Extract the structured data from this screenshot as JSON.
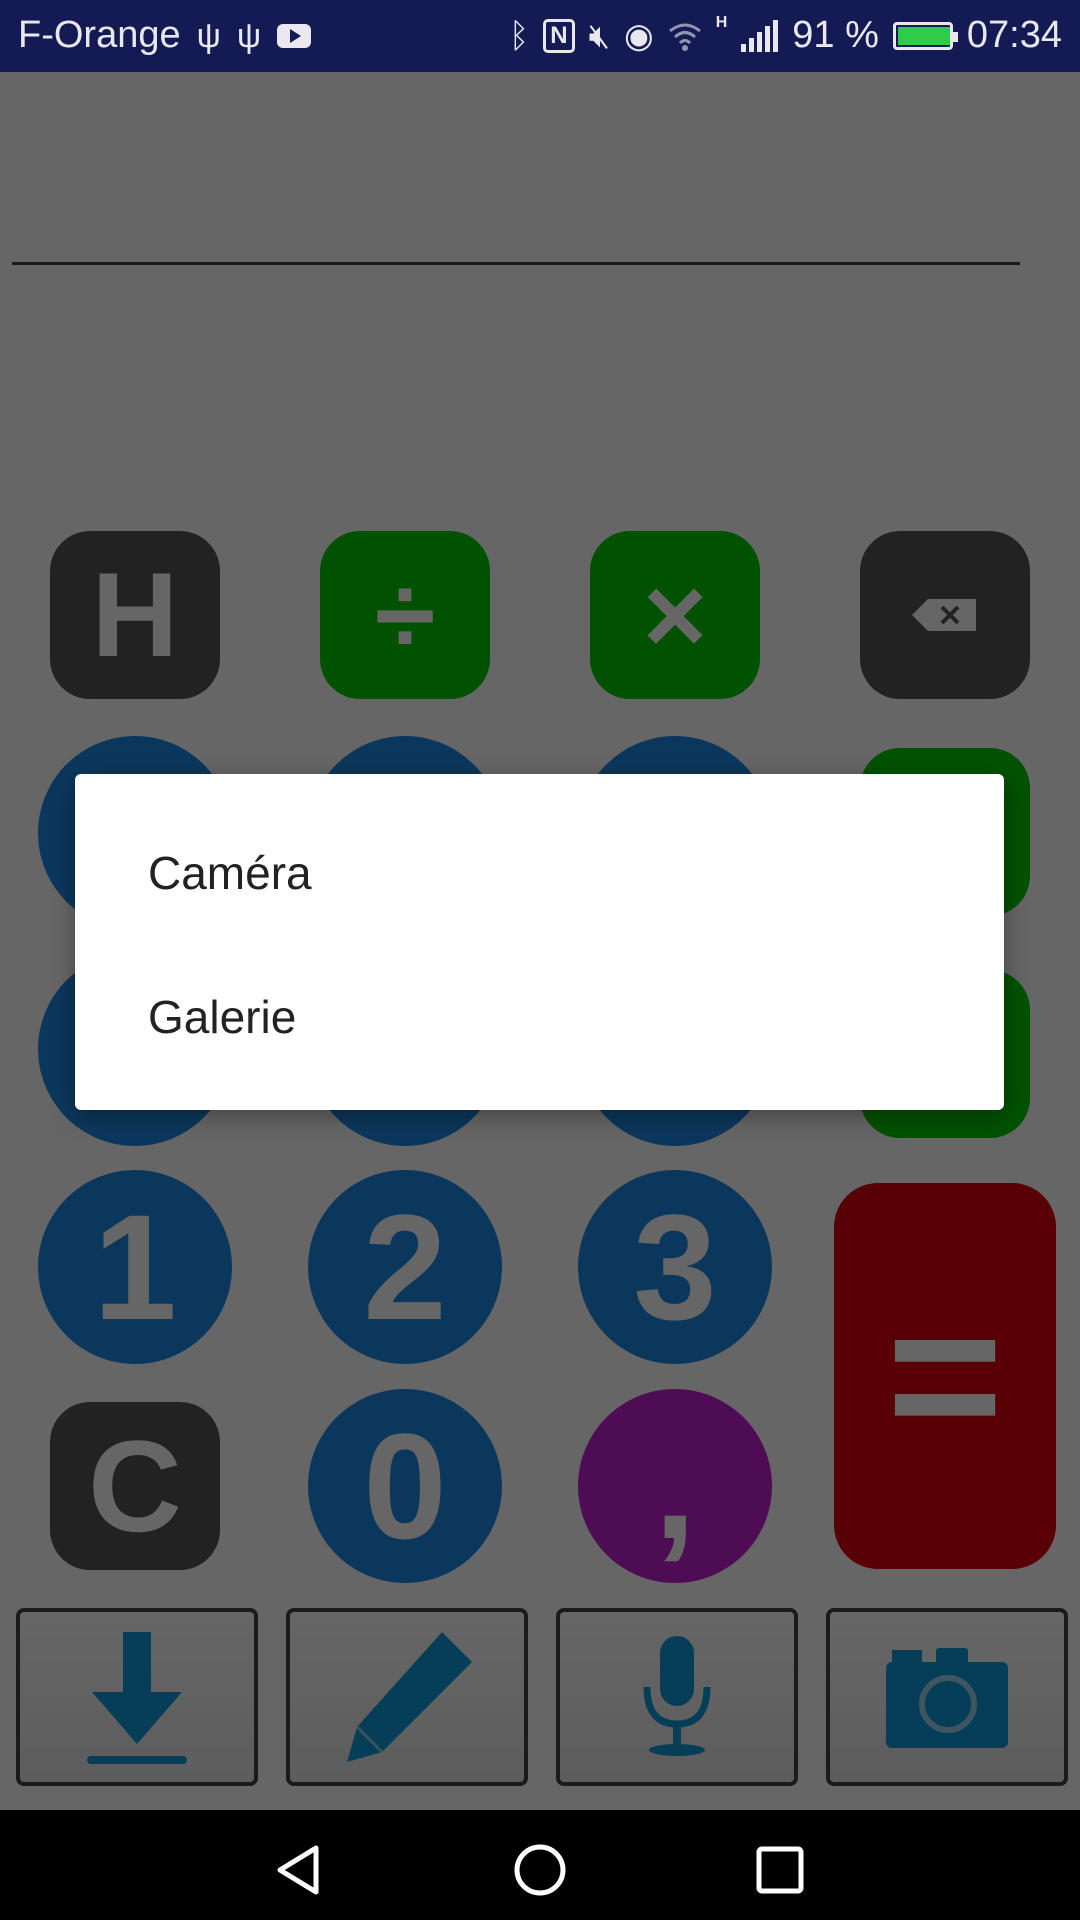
{
  "status_bar": {
    "carrier": "F-Orange",
    "battery_percent": "91 %",
    "time": "07:34",
    "network_type": "H",
    "icons": [
      "usb-icon",
      "usb-icon",
      "youtube-icon",
      "bluetooth-icon",
      "nfc-icon",
      "mute-icon",
      "eye-icon",
      "wifi-icon",
      "signal-icon",
      "battery-icon"
    ]
  },
  "keypad": {
    "row1": [
      "H",
      "÷",
      "×",
      "⌫"
    ],
    "row4": [
      "1",
      "2",
      "3"
    ],
    "row5": [
      "C",
      "0",
      ","
    ],
    "equals": "="
  },
  "toolbar": {
    "icons": [
      "download-icon",
      "pencil-icon",
      "microphone-icon",
      "camera-icon"
    ]
  },
  "dialog": {
    "option_camera": "Caméra",
    "option_gallery": "Galerie"
  },
  "colors": {
    "status_bar": "#141a54",
    "dark_key": "#555555",
    "green_key": "#00cc00",
    "blue_key": "#1e8be8",
    "purple_key": "#c21fd2",
    "red_key": "#dd0010",
    "toolbar_icon": "#0e9bd8",
    "battery_fill": "#2ecc4a"
  }
}
